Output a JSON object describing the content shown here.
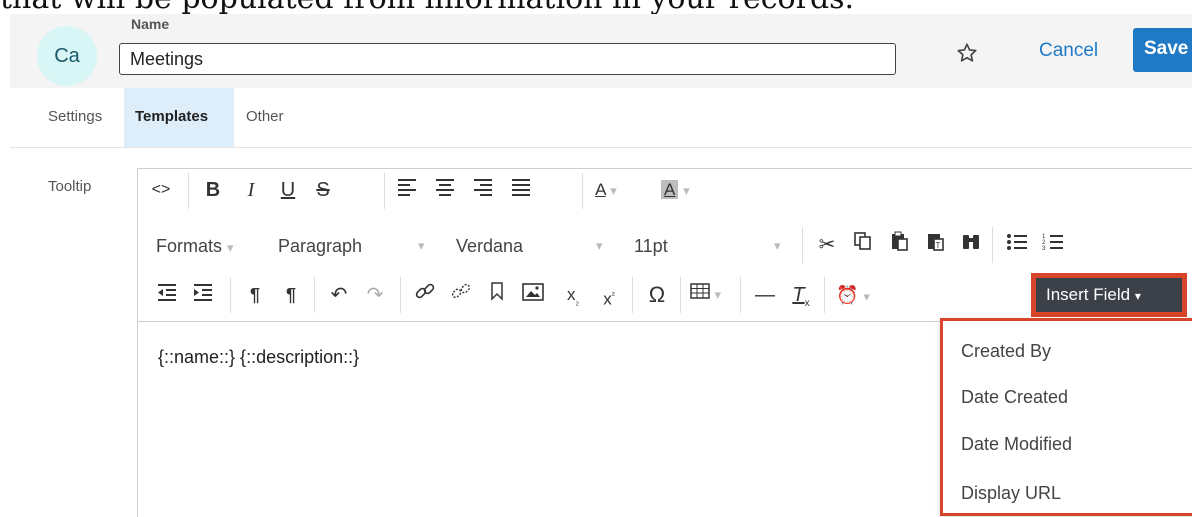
{
  "caption": "that will be populated from information in your records.",
  "header": {
    "avatar_text": "Ca",
    "avatar_color": "#d8f6f6",
    "name_label": "Name",
    "name_value": "Meetings",
    "star_icon": "star-outline-icon",
    "cancel_label": "Cancel",
    "save_label": "Save",
    "accent_color": "#1f79c4"
  },
  "tabs": [
    {
      "label": "Settings",
      "active": false
    },
    {
      "label": "Templates",
      "active": true
    },
    {
      "label": "Other",
      "active": false
    }
  ],
  "editor": {
    "field_label": "Tooltip",
    "toolbar_row1": [
      "source-code-icon",
      "bold-icon",
      "italic-icon",
      "underline-icon",
      "strikethrough-icon",
      "align-left-icon",
      "align-center-icon",
      "align-right-icon",
      "align-justify-icon",
      "text-color-icon",
      "background-color-icon"
    ],
    "formats_label": "Formats",
    "paragraph_label": "Paragraph",
    "font_label": "Verdana",
    "size_label": "11pt",
    "toolbar_row2_icons": [
      "cut-icon",
      "copy-icon",
      "paste-icon",
      "paste-text-icon",
      "find-icon",
      "bullet-list-icon",
      "numbered-list-icon"
    ],
    "toolbar_row3": [
      "outdent-icon",
      "indent-icon",
      "ltr-icon",
      "rtl-icon",
      "undo-icon",
      "redo-icon",
      "link-icon",
      "unlink-icon",
      "bookmark-icon",
      "image-icon",
      "subscript-icon",
      "superscript-icon",
      "special-char-icon",
      "table-icon",
      "horizontal-rule-icon",
      "clear-format-icon",
      "datetime-icon"
    ],
    "insert_field_label": "Insert Field",
    "content": "{::name::} {::description::}",
    "highlight_color": "#d9452b"
  },
  "insert_field_menu": [
    "Created By",
    "Date Created",
    "Date Modified",
    "Display URL"
  ]
}
